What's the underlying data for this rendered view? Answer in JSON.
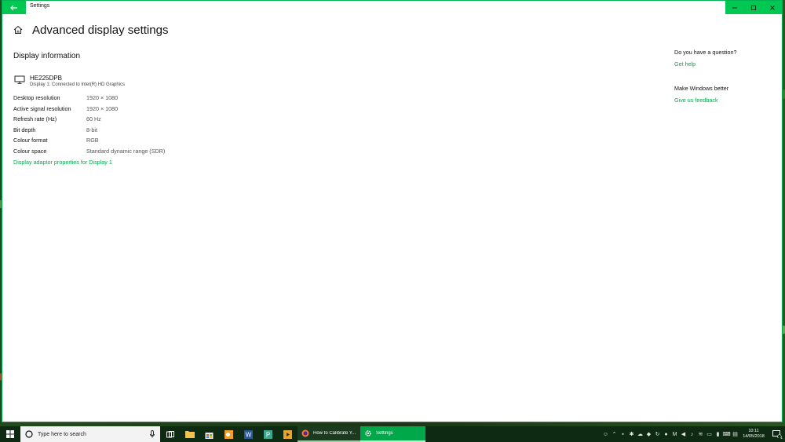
{
  "window": {
    "app_title": "Settings",
    "back_icon": "back-arrow-icon",
    "controls": [
      "minimize-icon",
      "maximize-icon",
      "close-icon"
    ]
  },
  "page": {
    "title": "Advanced display settings",
    "section_title": "Display information",
    "monitor": {
      "name": "HE225DPB",
      "subtitle": "Display 1: Connected to Intel(R) HD Graphics"
    },
    "info_rows": [
      {
        "label": "Desktop resolution",
        "value": "1920 × 1080"
      },
      {
        "label": "Active signal resolution",
        "value": "1920 × 1080"
      },
      {
        "label": "Refresh rate (Hz)",
        "value": "60 Hz"
      },
      {
        "label": "Bit depth",
        "value": "8-bit"
      },
      {
        "label": "Colour format",
        "value": "RGB"
      },
      {
        "label": "Colour space",
        "value": "Standard dynamic range (SDR)"
      }
    ],
    "adaptor_link": "Display adaptor properties for Display 1"
  },
  "side": {
    "question_heading": "Do you have a question?",
    "help_link": "Get help",
    "better_heading": "Make Windows better",
    "feedback_link": "Give us feedback"
  },
  "taskbar": {
    "search_placeholder": "Type here to search",
    "apps": [
      {
        "label": "How to Calibrate Y...",
        "icon": "firefox-icon"
      },
      {
        "label": "Settings",
        "icon": "gear-icon"
      }
    ],
    "clock_time": "10:11",
    "clock_date": "14/05/2018",
    "notification_count": "1"
  },
  "colors": {
    "accent": "#00c853",
    "link": "#00a84a",
    "taskbar": "#0e2a12"
  }
}
